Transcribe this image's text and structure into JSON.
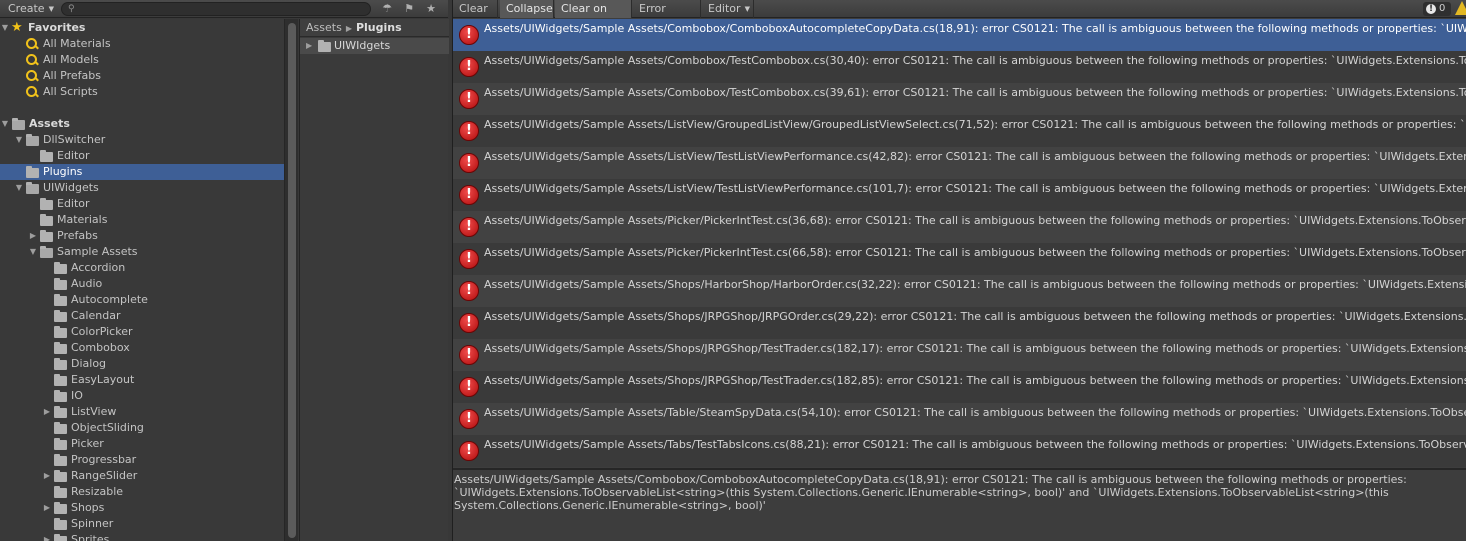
{
  "project": {
    "toolbar": {
      "create_label": "Create",
      "search_placeholder": ""
    },
    "tree": [
      {
        "label": "Favorites",
        "kind": "star",
        "level": 0,
        "caret": "down",
        "header": true
      },
      {
        "label": "All Materials",
        "kind": "search",
        "level": 1
      },
      {
        "label": "All Models",
        "kind": "search",
        "level": 1
      },
      {
        "label": "All Prefabs",
        "kind": "search",
        "level": 1
      },
      {
        "label": "All Scripts",
        "kind": "search",
        "level": 1
      },
      {
        "label": "",
        "kind": "spacer",
        "level": 0
      },
      {
        "label": "Assets",
        "kind": "folder",
        "level": 0,
        "caret": "down",
        "header": true
      },
      {
        "label": "DllSwitcher",
        "kind": "folder",
        "level": 1,
        "caret": "down"
      },
      {
        "label": "Editor",
        "kind": "folder",
        "level": 2
      },
      {
        "label": "Plugins",
        "kind": "folder",
        "level": 1,
        "selected": true
      },
      {
        "label": "UIWidgets",
        "kind": "folder",
        "level": 1,
        "caret": "down"
      },
      {
        "label": "Editor",
        "kind": "folder",
        "level": 2
      },
      {
        "label": "Materials",
        "kind": "folder",
        "level": 2
      },
      {
        "label": "Prefabs",
        "kind": "folder",
        "level": 2,
        "caret": "right"
      },
      {
        "label": "Sample Assets",
        "kind": "folder",
        "level": 2,
        "caret": "down"
      },
      {
        "label": "Accordion",
        "kind": "folder",
        "level": 3
      },
      {
        "label": "Audio",
        "kind": "folder",
        "level": 3
      },
      {
        "label": "Autocomplete",
        "kind": "folder",
        "level": 3
      },
      {
        "label": "Calendar",
        "kind": "folder",
        "level": 3
      },
      {
        "label": "ColorPicker",
        "kind": "folder",
        "level": 3
      },
      {
        "label": "Combobox",
        "kind": "folder",
        "level": 3
      },
      {
        "label": "Dialog",
        "kind": "folder",
        "level": 3
      },
      {
        "label": "EasyLayout",
        "kind": "folder",
        "level": 3
      },
      {
        "label": "IO",
        "kind": "folder",
        "level": 3
      },
      {
        "label": "ListView",
        "kind": "folder",
        "level": 3,
        "caret": "right"
      },
      {
        "label": "ObjectSliding",
        "kind": "folder",
        "level": 3
      },
      {
        "label": "Picker",
        "kind": "folder",
        "level": 3
      },
      {
        "label": "Progressbar",
        "kind": "folder",
        "level": 3
      },
      {
        "label": "RangeSlider",
        "kind": "folder",
        "level": 3,
        "caret": "right"
      },
      {
        "label": "Resizable",
        "kind": "folder",
        "level": 3
      },
      {
        "label": "Shops",
        "kind": "folder",
        "level": 3,
        "caret": "right"
      },
      {
        "label": "Spinner",
        "kind": "folder",
        "level": 3
      },
      {
        "label": "Sprites",
        "kind": "folder",
        "level": 3,
        "caret": "right"
      }
    ],
    "breadcrumb": {
      "root": "Assets",
      "current": "Plugins"
    },
    "assets": [
      {
        "label": "UIWIdgets"
      }
    ]
  },
  "console": {
    "toolbar": {
      "clear_label": "Clear",
      "collapse_label": "Collapse",
      "clear_on_play_label": "Clear on Play",
      "error_pause_label": "Error Pause",
      "editor_label": "Editor",
      "error_count": "0"
    },
    "logs": [
      {
        "text": "Assets/UIWidgets/Sample Assets/Combobox/ComboboxAutocompleteCopyData.cs(18,91): error CS0121: The call is ambiguous between the following methods or properties: `UIWidgets.Exte",
        "selected": true
      },
      {
        "text": "Assets/UIWidgets/Sample Assets/Combobox/TestCombobox.cs(30,40): error CS0121: The call is ambiguous between the following methods or properties: `UIWidgets.Extensions.ToOb"
      },
      {
        "text": "Assets/UIWidgets/Sample Assets/Combobox/TestCombobox.cs(39,61): error CS0121: The call is ambiguous between the following methods or properties: `UIWidgets.Extensions.ToOb"
      },
      {
        "text": "Assets/UIWidgets/Sample Assets/ListView/GroupedListView/GroupedListViewSelect.cs(71,52): error CS0121: The call is ambiguous between the following methods or properties: `UIW"
      },
      {
        "text": "Assets/UIWidgets/Sample Assets/ListView/TestListViewPerformance.cs(42,82): error CS0121: The call is ambiguous between the following methods or properties: `UIWidgets.Extensions"
      },
      {
        "text": "Assets/UIWidgets/Sample Assets/ListView/TestListViewPerformance.cs(101,7): error CS0121: The call is ambiguous between the following methods or properties: `UIWidgets.Extensions"
      },
      {
        "text": "Assets/UIWidgets/Sample Assets/Picker/PickerIntTest.cs(36,68): error CS0121: The call is ambiguous between the following methods or properties: `UIWidgets.Extensions.ToObservab"
      },
      {
        "text": "Assets/UIWidgets/Sample Assets/Picker/PickerIntTest.cs(66,58): error CS0121: The call is ambiguous between the following methods or properties: `UIWidgets.Extensions.ToObservab"
      },
      {
        "text": "Assets/UIWidgets/Sample Assets/Shops/HarborShop/HarborOrder.cs(32,22): error CS0121: The call is ambiguous between the following methods or properties: `UIWidgets.Extensions.T"
      },
      {
        "text": "Assets/UIWidgets/Sample Assets/Shops/JRPGShop/JRPGOrder.cs(29,22): error CS0121: The call is ambiguous between the following methods or properties: `UIWidgets.Extensions.ToObse"
      },
      {
        "text": "Assets/UIWidgets/Sample Assets/Shops/JRPGShop/TestTrader.cs(182,17): error CS0121: The call is ambiguous between the following methods or properties: `UIWidgets.Extensions.ToOb"
      },
      {
        "text": "Assets/UIWidgets/Sample Assets/Shops/JRPGShop/TestTrader.cs(182,85): error CS0121: The call is ambiguous between the following methods or properties: `UIWidgets.Extensions.ToOb"
      },
      {
        "text": "Assets/UIWidgets/Sample Assets/Table/SteamSpyData.cs(54,10): error CS0121: The call is ambiguous between the following methods or properties: `UIWidgets.Extensions.ToObservable"
      },
      {
        "text": "Assets/UIWidgets/Sample Assets/Tabs/TestTabsIcons.cs(88,21): error CS0121: The call is ambiguous between the following methods or properties: `UIWidgets.Extensions.ToObservabl"
      }
    ],
    "detail": "Assets/UIWidgets/Sample Assets/Combobox/ComboboxAutocompleteCopyData.cs(18,91): error CS0121: The call is ambiguous between the following methods or properties:\n`UIWidgets.Extensions.ToObservableList<string>(this System.Collections.Generic.IEnumerable<string>, bool)' and `UIWidgets.Extensions.ToObservableList<string>(this\nSystem.Collections.Generic.IEnumerable<string>, bool)'",
    "colors": {
      "selection": "#3e5f96",
      "error": "#d22020",
      "warning": "#e3b822"
    }
  }
}
